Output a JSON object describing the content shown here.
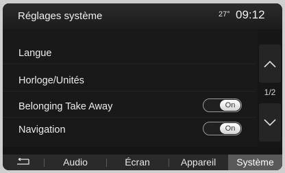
{
  "header": {
    "title": "Réglages système",
    "temperature": "27°",
    "time": "09:12"
  },
  "settings": [
    {
      "label": "Langue"
    },
    {
      "label": "Horloge/Unités"
    },
    {
      "label": "Belonging Take Away",
      "toggle": "On"
    },
    {
      "label": "Navigation",
      "toggle": "On"
    }
  ],
  "pagination": {
    "indicator": "1/2",
    "up_icon": "chevron-up-icon",
    "down_icon": "chevron-down-icon"
  },
  "tabs": {
    "back_icon": "back-arrow-icon",
    "items": [
      {
        "label": "Audio"
      },
      {
        "label": "Écran"
      },
      {
        "label": "Appareil"
      },
      {
        "label": "Système",
        "active": true
      }
    ]
  }
}
